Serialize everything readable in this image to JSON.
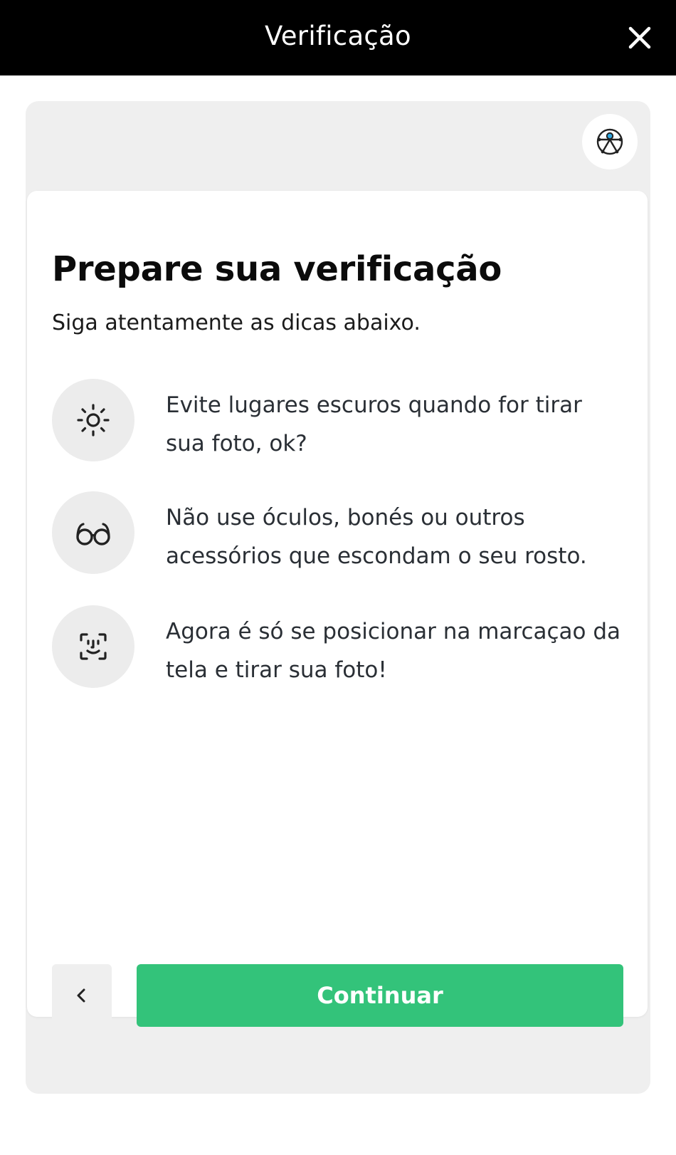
{
  "header": {
    "title": "Verificação",
    "close_icon": "close-icon"
  },
  "accessibility": {
    "icon": "accessibility-icon"
  },
  "content": {
    "heading": "Prepare sua verificação",
    "subtitle": "Siga atentamente as dicas abaixo.",
    "tips": [
      {
        "icon": "sun-icon",
        "text": "Evite lugares escuros quando for tirar sua foto, ok?"
      },
      {
        "icon": "glasses-icon",
        "text": "Não use óculos, bonés ou outros acessórios que escondam o seu rosto."
      },
      {
        "icon": "face-scan-icon",
        "text": "Agora é só se posicionar na marcaçao da tela e tirar sua foto!"
      }
    ]
  },
  "footer": {
    "back_icon": "chevron-left-icon",
    "continue_label": "Continuar"
  },
  "colors": {
    "header_background": "#000000",
    "outer_card": "#efefef",
    "primary_button": "#33c37a",
    "accessibility_accent": "#2ea6e0"
  }
}
